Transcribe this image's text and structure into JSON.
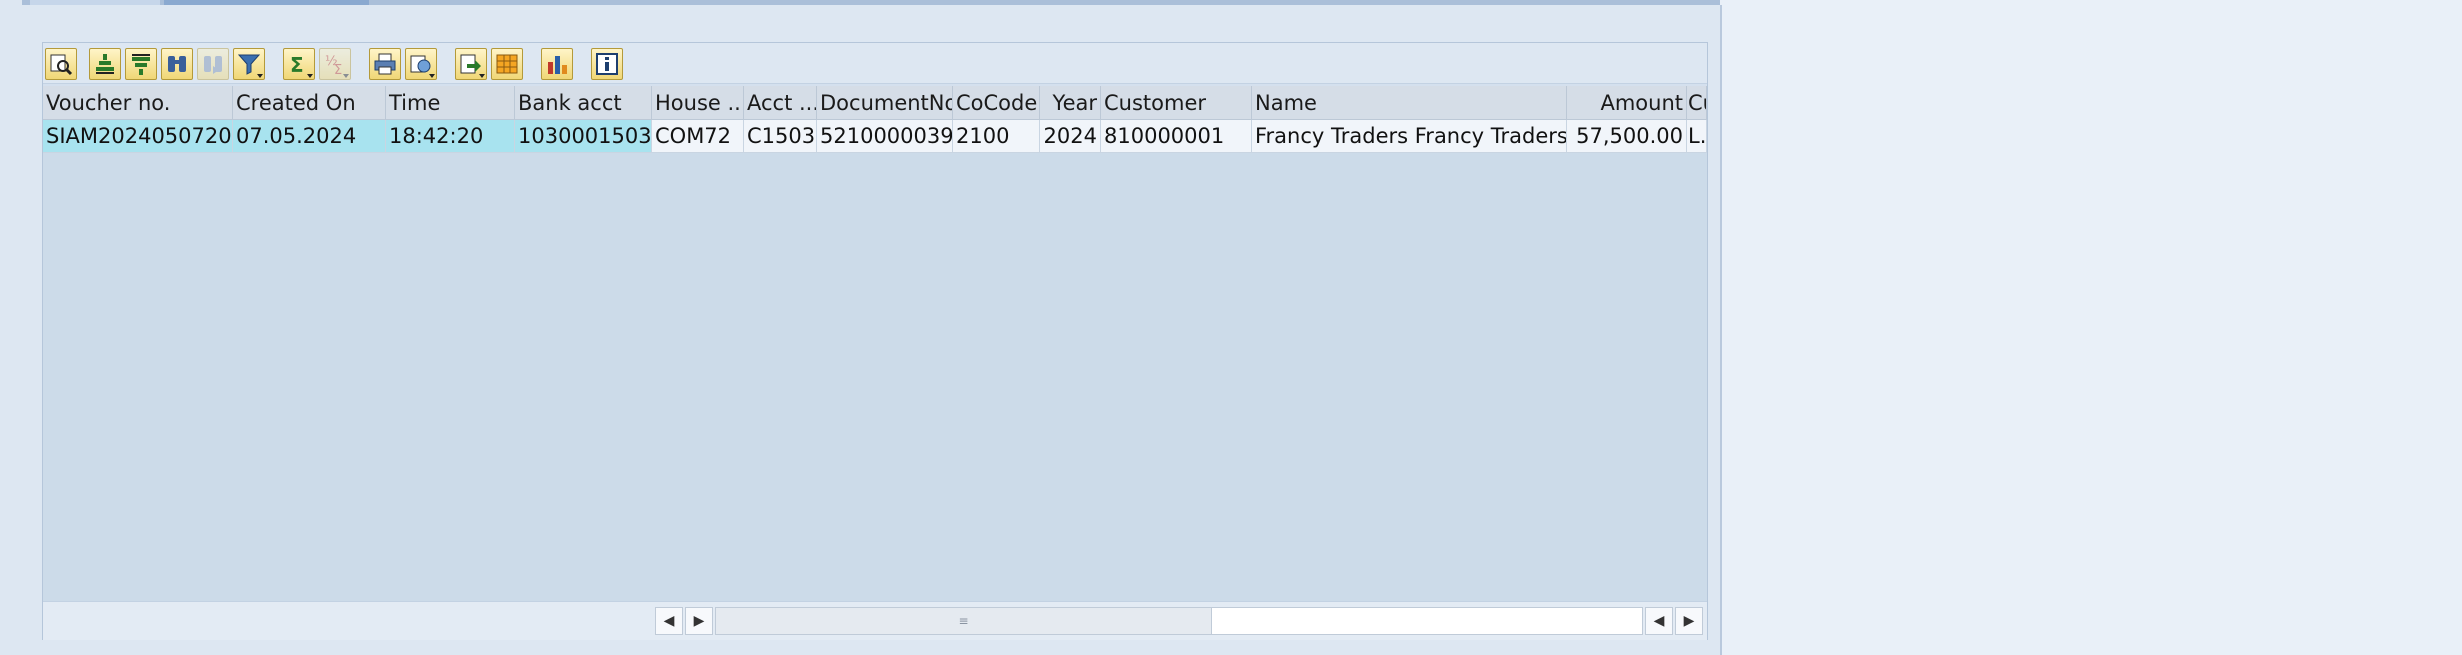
{
  "toolbar": {
    "buttons": [
      "details-icon",
      "sort-ascending-icon",
      "sort-descending-icon",
      "find-icon",
      "find-next-icon",
      "filter-icon",
      "total-icon",
      "subtotal-icon",
      "print-icon",
      "export-icon",
      "export-file-icon",
      "layout-icon",
      "chart-icon",
      "info-icon"
    ]
  },
  "table": {
    "columns": [
      "Voucher no.",
      "Created On",
      "Time",
      "Bank acct",
      "House ...",
      "Acct ...",
      "DocumentNo",
      "CoCode",
      "Year",
      "Customer",
      "Name",
      "Amount",
      "Cu"
    ],
    "rows": [
      [
        "SIAM2024050720",
        "07.05.2024",
        "18:42:20",
        "1030001503",
        "COM72",
        "C1503",
        "5210000039",
        "2100",
        "2024",
        "810000001",
        "Francy Traders Francy Traders",
        "57,500.00",
        "L..."
      ]
    ]
  },
  "colors": {
    "key_cell": "#a8e3ef",
    "grid_bg": "#ccdbe9",
    "header_bg": "#d5dde7"
  }
}
